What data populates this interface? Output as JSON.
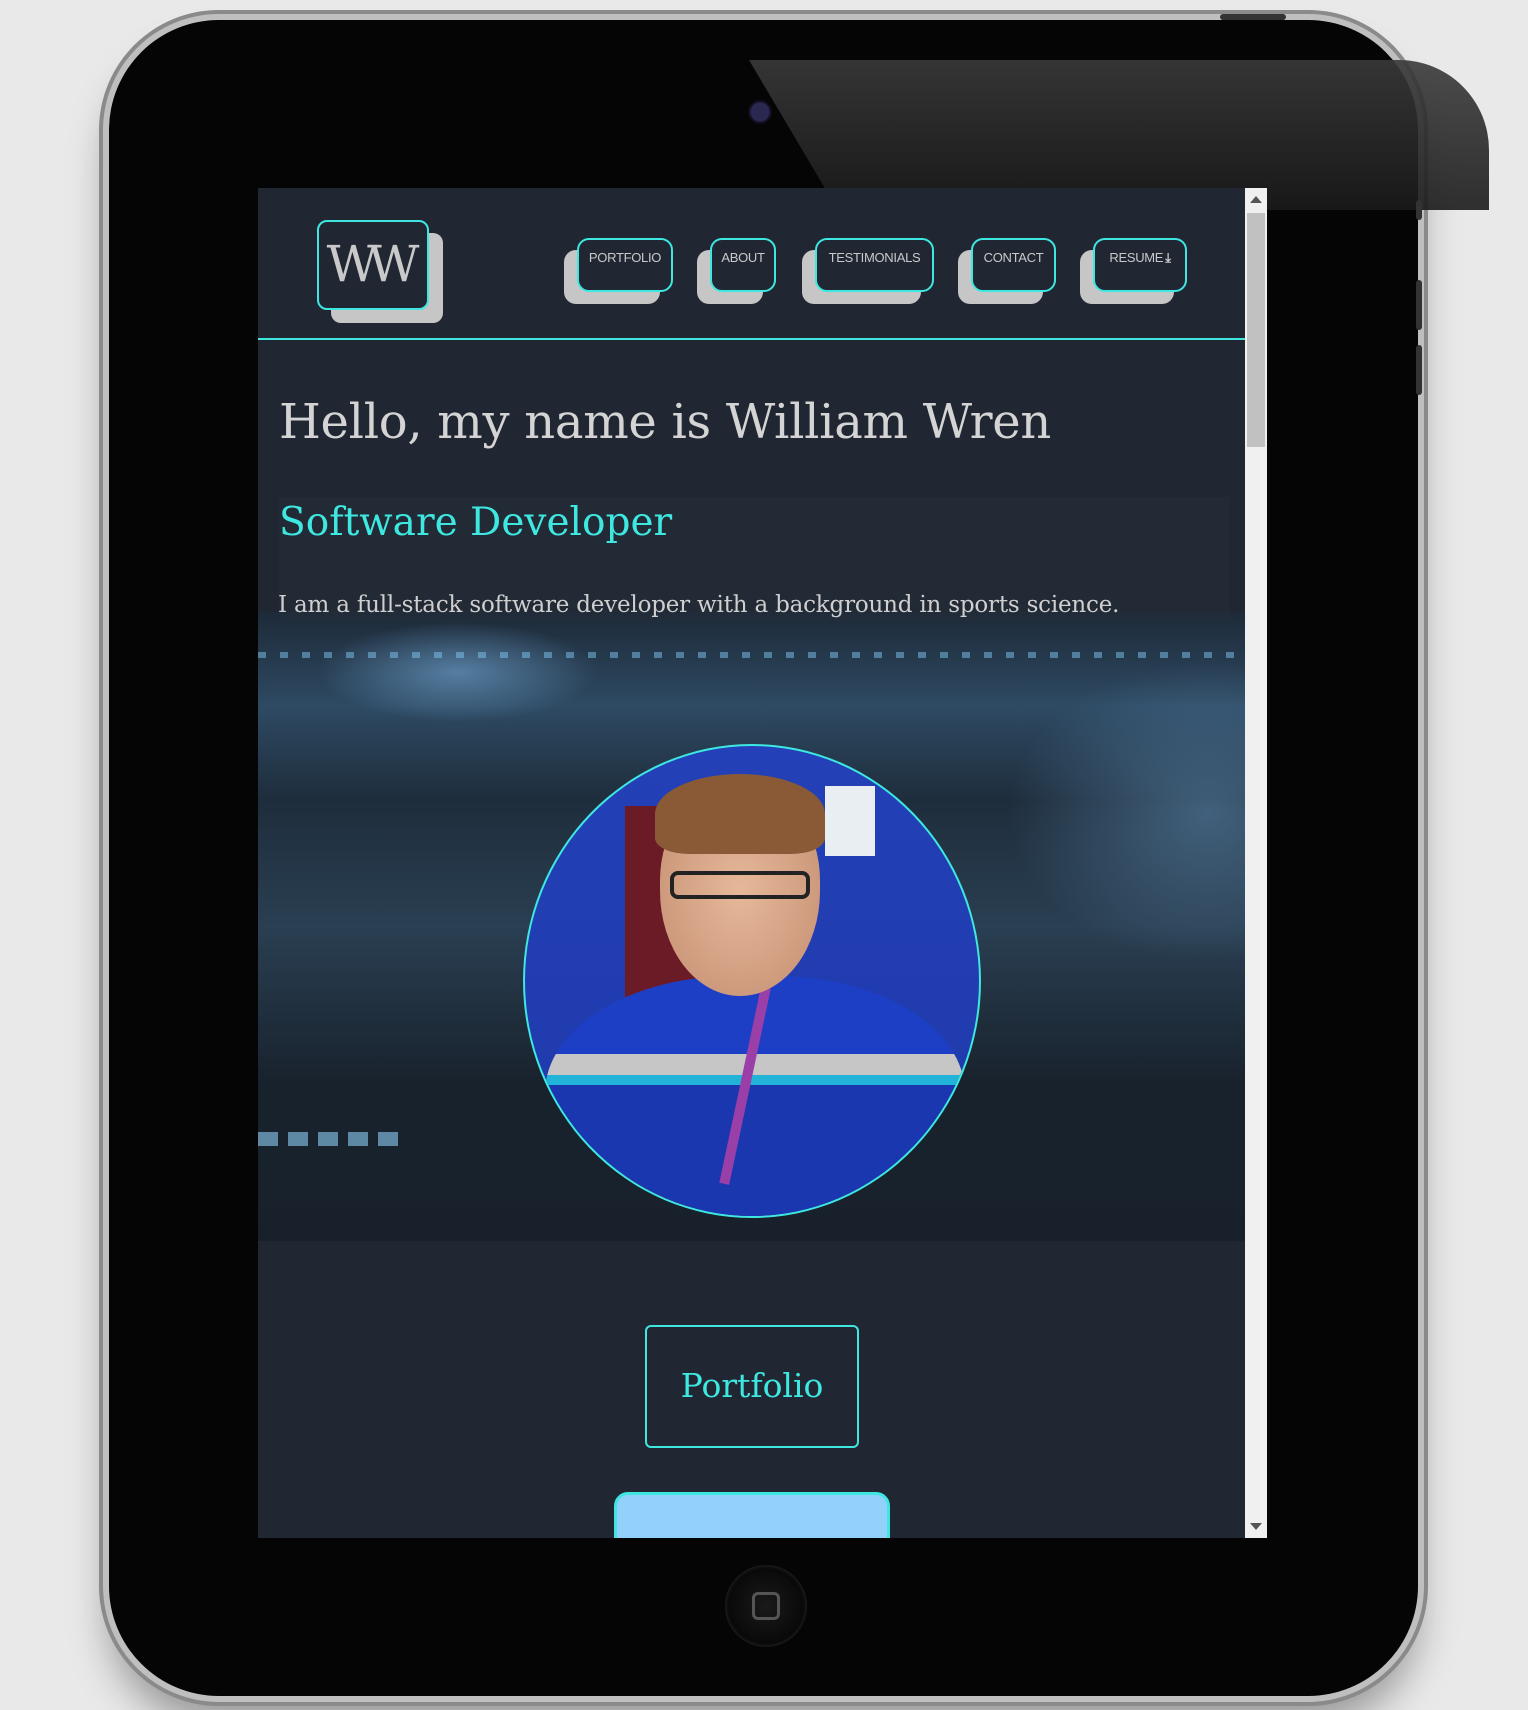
{
  "header": {
    "logo": "WW",
    "nav": [
      {
        "label": "PORTFOLIO"
      },
      {
        "label": "ABOUT"
      },
      {
        "label": "TESTIMONIALS"
      },
      {
        "label": "CONTACT"
      },
      {
        "label": "RESUME",
        "icon": "download-icon"
      }
    ]
  },
  "hero": {
    "title": "Hello, my name is William Wren",
    "subtitle": "Software Developer",
    "intro": "I am a full-stack software developer with a background in sports science."
  },
  "buttons": {
    "portfolio": "Portfolio"
  },
  "colors": {
    "accent": "#3ee7e0",
    "background": "#202733",
    "button_fill": "#93d0fb"
  }
}
